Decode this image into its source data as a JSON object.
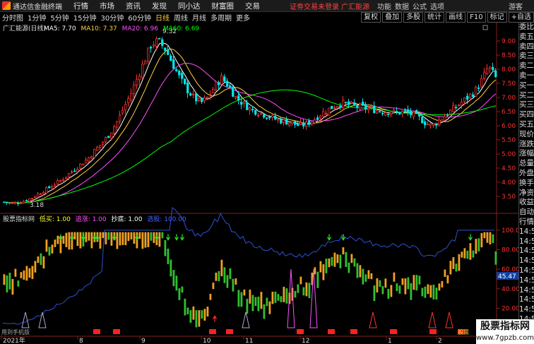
{
  "app": {
    "title": "通达信金融终端"
  },
  "menu": [
    "行情",
    "市场",
    "资讯",
    "发现",
    "同小达",
    "财富圈",
    "交易"
  ],
  "header_notice": "证劵交易未登录 广汇能源",
  "system_menu": [
    "功能",
    "数据",
    "公式",
    "选项",
    "游客"
  ],
  "toolbar": {
    "periods": [
      "分时图",
      "1分钟",
      "5分钟",
      "15分钟",
      "30分钟",
      "60分钟",
      "日线",
      "周线",
      "月线",
      "多周期",
      "更多"
    ],
    "active_period": "日线",
    "right_buttons": [
      "复权",
      "叠加",
      "多股",
      "统计",
      "画线",
      "F10",
      "标记",
      "+自选"
    ]
  },
  "right_panel": {
    "items": [
      "委比",
      "卖五",
      "卖四",
      "卖三",
      "卖二",
      "卖一",
      "买一",
      "买二",
      "买三",
      "买四",
      "买五",
      "现价",
      "涨跌",
      "涨幅",
      "总量",
      "外盘",
      "换手",
      "净资",
      "收益",
      "自动",
      "行情",
      "14:5",
      "14:5",
      "14:5",
      "14:5",
      "14:5",
      "14:5",
      "14:5",
      "14:5",
      "14:5",
      "14:5"
    ]
  },
  "colors": {
    "up": "#ff3232",
    "down": "#00e6e6",
    "ma5": "#ffffff",
    "ma10": "#ffd23c",
    "ma20": "#ff50ff",
    "ma60": "#00ff00",
    "ind_up": "#f0a020",
    "ind_down": "#30c030"
  },
  "chart_data": {
    "type": "candlestick",
    "title": "广汇能源(日线)",
    "ma_legend": [
      {
        "name": "MA5",
        "value": "7.70"
      },
      {
        "name": "MA10",
        "value": "7.37"
      },
      {
        "name": "MA20",
        "value": "6.96"
      },
      {
        "name": "MA60",
        "value": "6.69"
      }
    ],
    "y_ticks": [
      3.5,
      4.0,
      4.5,
      5.0,
      5.5,
      6.0,
      6.5,
      7.0,
      7.5,
      8.0,
      8.5,
      9.0
    ],
    "y_range": [
      3.0,
      9.3
    ],
    "high_label": "9.32",
    "low_label": "3.18",
    "x_labels": [
      "2021年",
      "8",
      "9",
      "10",
      "11",
      "12",
      "1",
      "2"
    ],
    "close_trend": [
      3.3,
      3.25,
      3.28,
      3.35,
      3.45,
      3.6,
      3.75,
      3.9,
      4.05,
      4.25,
      4.45,
      4.65,
      4.85,
      5.15,
      5.4,
      5.7,
      6.1,
      6.6,
      7.1,
      7.7,
      8.3,
      8.9,
      9.0,
      8.7,
      8.2,
      7.7,
      7.3,
      7.0,
      6.8,
      7.0,
      7.4,
      7.7,
      7.4,
      7.0,
      6.8,
      6.6,
      6.5,
      6.4,
      6.3,
      6.2,
      6.15,
      6.1,
      6.0,
      6.05,
      6.2,
      6.4,
      6.55,
      6.7,
      6.8,
      6.75,
      6.7,
      6.65,
      6.6,
      6.55,
      6.5,
      6.5,
      6.45,
      6.5,
      6.4,
      6.3,
      6.1,
      6.0,
      6.2,
      6.4,
      6.6,
      6.8,
      7.0,
      7.2,
      7.6,
      8.1,
      7.7
    ],
    "indicator": {
      "name": "股票指标网",
      "labels": [
        {
          "name": "低买",
          "value": "1.00"
        },
        {
          "name": "追涨",
          "value": "1.00"
        },
        {
          "name": "抄底",
          "value": "1.00"
        },
        {
          "name": "选股",
          "value": "100.00"
        }
      ],
      "y_ticks": [
        20.0,
        40.0,
        60.0,
        80.0,
        100.0
      ],
      "y_range": [
        0,
        105
      ],
      "current_value": "45.47",
      "footer_label": "用到手机版",
      "signal_label": "股票"
    }
  },
  "watermark": {
    "line1": "股票指标网",
    "line2": "www.7gpzb.com"
  }
}
